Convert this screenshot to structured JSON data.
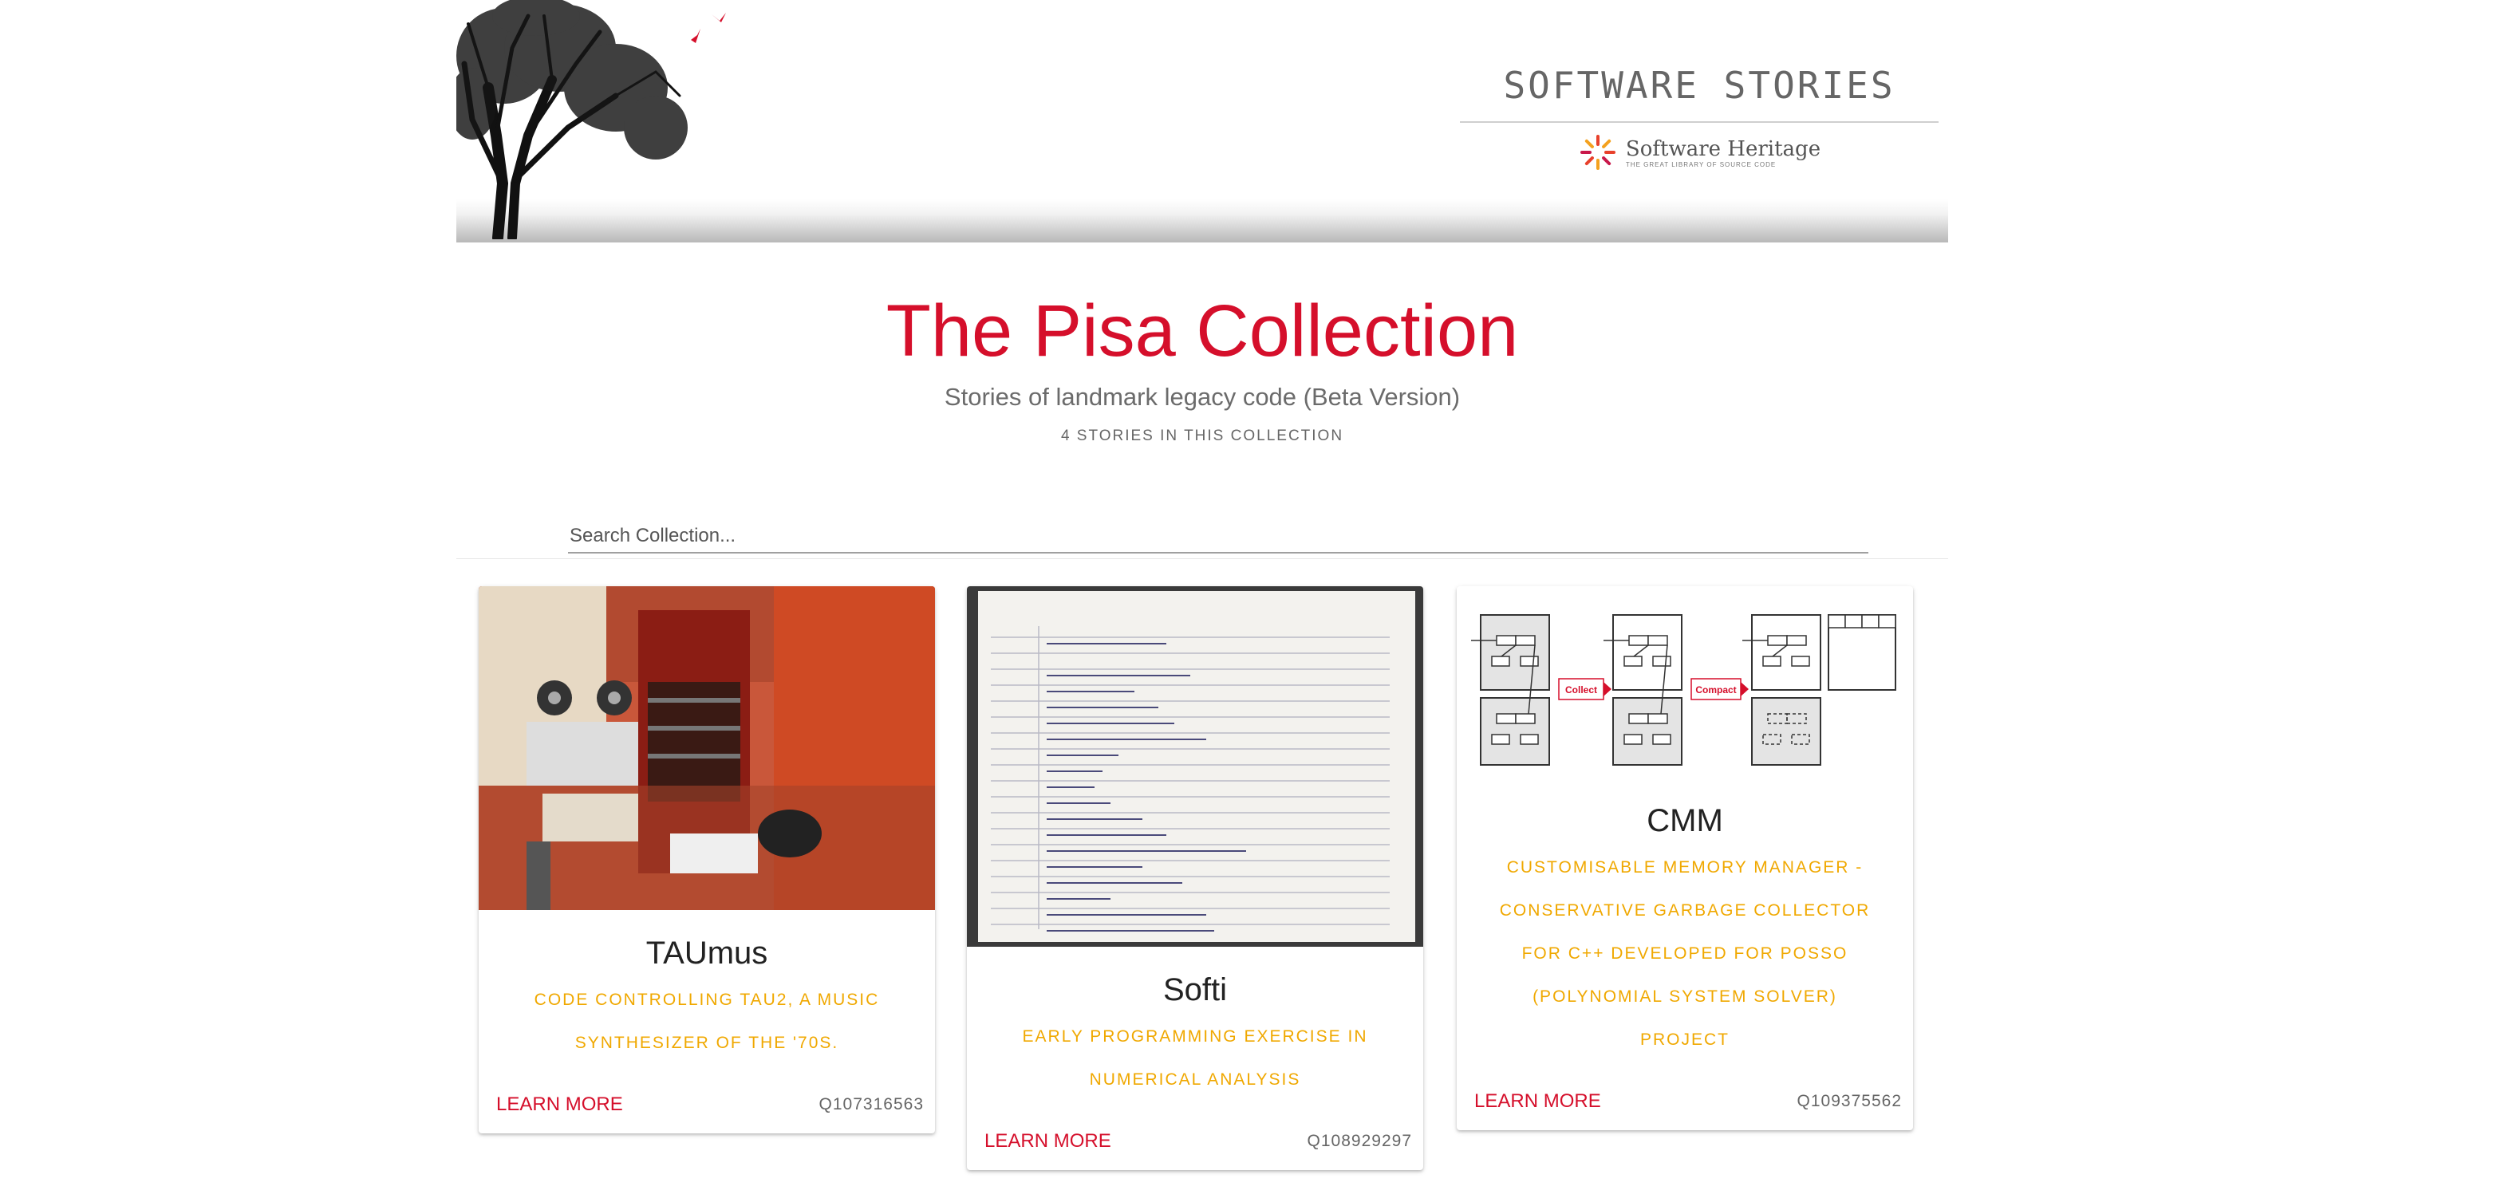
{
  "header": {
    "brand_title": "SOFTWARE STORIES",
    "logo_name": "Software Heritage",
    "logo_tagline": "THE GREAT LIBRARY OF SOURCE CODE"
  },
  "collection": {
    "title": "The Pisa Collection",
    "subtitle": "Stories of landmark legacy code (Beta Version)",
    "count": "4 STORIES IN THIS COLLECTION"
  },
  "search": {
    "placeholder": "Search Collection..."
  },
  "cards": [
    {
      "title": "TAUmus",
      "description": "CODE CONTROLLING TAU2, A MUSIC SYNTHESIZER OF THE '70S.",
      "link": "LEARN MORE",
      "qid": "Q107316563"
    },
    {
      "title": "Softi",
      "description": "EARLY PROGRAMMING EXERCISE IN NUMERICAL ANALYSIS",
      "link": "LEARN MORE",
      "qid": "Q108929297"
    },
    {
      "title": "CMM",
      "description": "CUSTOMISABLE MEMORY MANAGER - CONSERVATIVE GARBAGE COLLECTOR FOR C++ DEVELOPED FOR POSSO (POLYNOMIAL SYSTEM SOLVER) PROJECT",
      "link": "LEARN MORE",
      "qid": "Q109375562",
      "diagram_labels": [
        "Collect",
        "Compact"
      ]
    }
  ],
  "colors": {
    "accent": "#d50f2b",
    "description": "#f0a800"
  }
}
